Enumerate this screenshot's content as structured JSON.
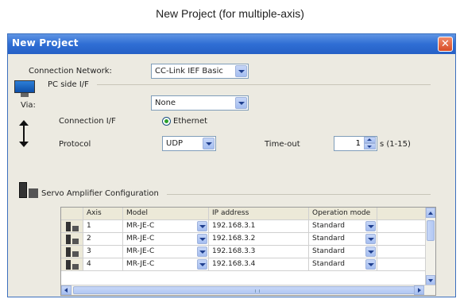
{
  "caption": "New Project (for multiple-axis)",
  "window": {
    "title": "New Project",
    "close_label": "✕"
  },
  "connection_network": {
    "label": "Connection Network:",
    "value": "CC-Link IEF Basic"
  },
  "via": {
    "label": "Via:",
    "value": "None"
  },
  "pc_side": {
    "label": "PC side I/F",
    "connection_label": "Connection I/F",
    "connection_value": "Ethernet",
    "protocol_label": "Protocol",
    "protocol_value": "UDP",
    "timeout_label": "Time-out",
    "timeout_value": "1",
    "timeout_unit": "s (1-15)"
  },
  "servo": {
    "label": "Servo Amplifier Configuration",
    "columns": [
      "Axis",
      "Model",
      "IP address",
      "Operation mode"
    ],
    "rows": [
      {
        "axis": "1",
        "model": "MR-JE-C",
        "ip": "192.168.3.1",
        "mode": "Standard"
      },
      {
        "axis": "2",
        "model": "MR-JE-C",
        "ip": "192.168.3.2",
        "mode": "Standard"
      },
      {
        "axis": "3",
        "model": "MR-JE-C",
        "ip": "192.168.3.3",
        "mode": "Standard"
      },
      {
        "axis": "4",
        "model": "MR-JE-C",
        "ip": "192.168.3.4",
        "mode": "Standard"
      }
    ]
  },
  "colors": {
    "titlebar": "#2f6ed4",
    "dialog_bg": "#eceae1",
    "close": "#d74c26"
  }
}
